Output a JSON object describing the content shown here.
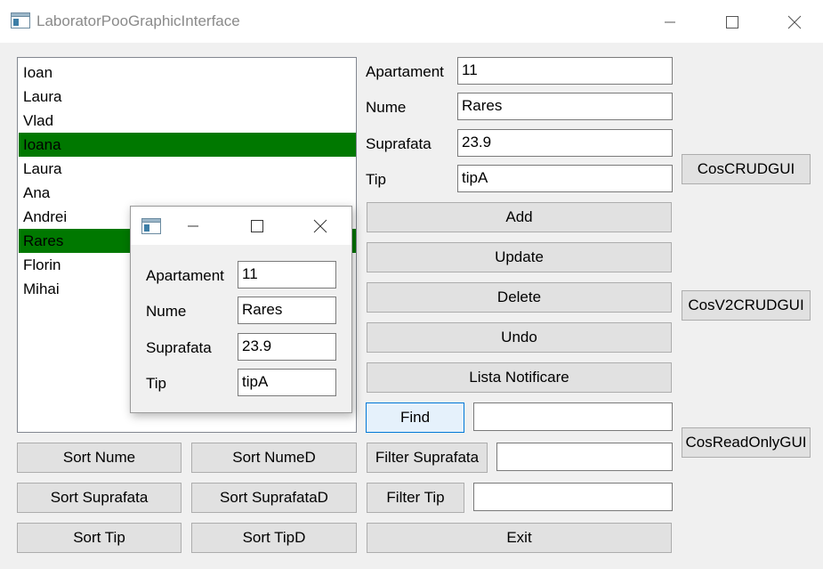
{
  "window": {
    "title": "LaboratorPooGraphicInterface"
  },
  "list": {
    "items": [
      {
        "label": "Ioan",
        "selected": false
      },
      {
        "label": "Laura",
        "selected": false
      },
      {
        "label": "Vlad",
        "selected": false
      },
      {
        "label": "Ioana",
        "selected": true
      },
      {
        "label": "Laura",
        "selected": false
      },
      {
        "label": "Ana",
        "selected": false
      },
      {
        "label": "Andrei",
        "selected": false
      },
      {
        "label": "Rares",
        "selected": true
      },
      {
        "label": "Florin",
        "selected": false
      },
      {
        "label": "Mihai",
        "selected": false
      }
    ],
    "selection_color": "#007800"
  },
  "form": {
    "apartament_label": "Apartament",
    "apartament_value": "11",
    "nume_label": "Nume",
    "nume_value": "Rares",
    "suprafata_label": "Suprafata",
    "suprafata_value": "23.9",
    "tip_label": "Tip",
    "tip_value": "tipA"
  },
  "actions": {
    "add": "Add",
    "update": "Update",
    "delete": "Delete",
    "undo": "Undo",
    "lista_notificare": "Lista Notificare",
    "find": "Find",
    "find_value": "",
    "filter_suprafata": "Filter Suprafata",
    "filter_suprafata_value": "",
    "filter_tip": "Filter Tip",
    "filter_tip_value": "",
    "exit": "Exit"
  },
  "sort": {
    "nume": "Sort Nume",
    "nume_d": "Sort NumeD",
    "suprafata": "Sort Suprafata",
    "suprafata_d": "Sort SuprafataD",
    "tip": "Sort Tip",
    "tip_d": "Sort TipD"
  },
  "side": {
    "cos_crud": "CosCRUDGUI",
    "cos_v2_crud": "CosV2CRUDGUI",
    "cos_read_only": "CosReadOnlyGUI"
  },
  "popup": {
    "apartament_label": "Apartament",
    "apartament_value": "11",
    "nume_label": "Nume",
    "nume_value": "Rares",
    "suprafata_label": "Suprafata",
    "suprafata_value": "23.9",
    "tip_label": "Tip",
    "tip_value": "tipA"
  },
  "icons": {
    "app": "app-window-icon",
    "minimize": "minimize-icon",
    "maximize": "maximize-icon",
    "close": "close-icon"
  }
}
